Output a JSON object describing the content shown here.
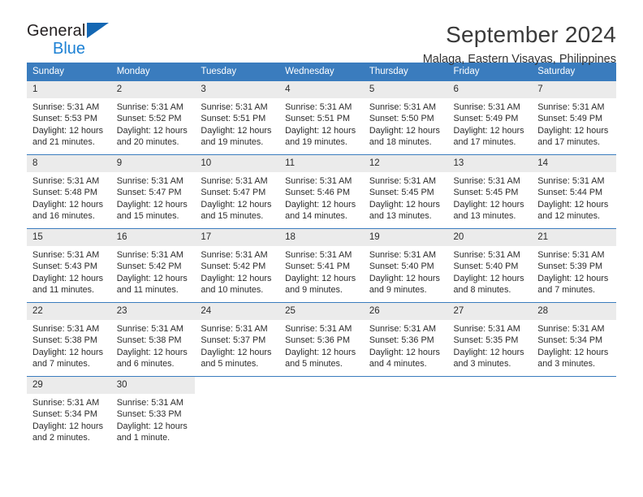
{
  "brand": {
    "name_top": "General",
    "name_bottom": "Blue",
    "triangle_color": "#1467b3",
    "blue_text_color": "#1d81d4"
  },
  "header": {
    "month_title": "September 2024",
    "location": "Malaga, Eastern Visayas, Philippines"
  },
  "theme": {
    "header_blue": "#3a7cbe",
    "daynum_bg": "#ebebeb",
    "text": "#2b2b2b"
  },
  "calendar": {
    "day_names": [
      "Sunday",
      "Monday",
      "Tuesday",
      "Wednesday",
      "Thursday",
      "Friday",
      "Saturday"
    ],
    "weeks": [
      [
        {
          "day": "1",
          "sunrise": "Sunrise: 5:31 AM",
          "sunset": "Sunset: 5:53 PM",
          "daylight1": "Daylight: 12 hours",
          "daylight2": "and 21 minutes."
        },
        {
          "day": "2",
          "sunrise": "Sunrise: 5:31 AM",
          "sunset": "Sunset: 5:52 PM",
          "daylight1": "Daylight: 12 hours",
          "daylight2": "and 20 minutes."
        },
        {
          "day": "3",
          "sunrise": "Sunrise: 5:31 AM",
          "sunset": "Sunset: 5:51 PM",
          "daylight1": "Daylight: 12 hours",
          "daylight2": "and 19 minutes."
        },
        {
          "day": "4",
          "sunrise": "Sunrise: 5:31 AM",
          "sunset": "Sunset: 5:51 PM",
          "daylight1": "Daylight: 12 hours",
          "daylight2": "and 19 minutes."
        },
        {
          "day": "5",
          "sunrise": "Sunrise: 5:31 AM",
          "sunset": "Sunset: 5:50 PM",
          "daylight1": "Daylight: 12 hours",
          "daylight2": "and 18 minutes."
        },
        {
          "day": "6",
          "sunrise": "Sunrise: 5:31 AM",
          "sunset": "Sunset: 5:49 PM",
          "daylight1": "Daylight: 12 hours",
          "daylight2": "and 17 minutes."
        },
        {
          "day": "7",
          "sunrise": "Sunrise: 5:31 AM",
          "sunset": "Sunset: 5:49 PM",
          "daylight1": "Daylight: 12 hours",
          "daylight2": "and 17 minutes."
        }
      ],
      [
        {
          "day": "8",
          "sunrise": "Sunrise: 5:31 AM",
          "sunset": "Sunset: 5:48 PM",
          "daylight1": "Daylight: 12 hours",
          "daylight2": "and 16 minutes."
        },
        {
          "day": "9",
          "sunrise": "Sunrise: 5:31 AM",
          "sunset": "Sunset: 5:47 PM",
          "daylight1": "Daylight: 12 hours",
          "daylight2": "and 15 minutes."
        },
        {
          "day": "10",
          "sunrise": "Sunrise: 5:31 AM",
          "sunset": "Sunset: 5:47 PM",
          "daylight1": "Daylight: 12 hours",
          "daylight2": "and 15 minutes."
        },
        {
          "day": "11",
          "sunrise": "Sunrise: 5:31 AM",
          "sunset": "Sunset: 5:46 PM",
          "daylight1": "Daylight: 12 hours",
          "daylight2": "and 14 minutes."
        },
        {
          "day": "12",
          "sunrise": "Sunrise: 5:31 AM",
          "sunset": "Sunset: 5:45 PM",
          "daylight1": "Daylight: 12 hours",
          "daylight2": "and 13 minutes."
        },
        {
          "day": "13",
          "sunrise": "Sunrise: 5:31 AM",
          "sunset": "Sunset: 5:45 PM",
          "daylight1": "Daylight: 12 hours",
          "daylight2": "and 13 minutes."
        },
        {
          "day": "14",
          "sunrise": "Sunrise: 5:31 AM",
          "sunset": "Sunset: 5:44 PM",
          "daylight1": "Daylight: 12 hours",
          "daylight2": "and 12 minutes."
        }
      ],
      [
        {
          "day": "15",
          "sunrise": "Sunrise: 5:31 AM",
          "sunset": "Sunset: 5:43 PM",
          "daylight1": "Daylight: 12 hours",
          "daylight2": "and 11 minutes."
        },
        {
          "day": "16",
          "sunrise": "Sunrise: 5:31 AM",
          "sunset": "Sunset: 5:42 PM",
          "daylight1": "Daylight: 12 hours",
          "daylight2": "and 11 minutes."
        },
        {
          "day": "17",
          "sunrise": "Sunrise: 5:31 AM",
          "sunset": "Sunset: 5:42 PM",
          "daylight1": "Daylight: 12 hours",
          "daylight2": "and 10 minutes."
        },
        {
          "day": "18",
          "sunrise": "Sunrise: 5:31 AM",
          "sunset": "Sunset: 5:41 PM",
          "daylight1": "Daylight: 12 hours",
          "daylight2": "and 9 minutes."
        },
        {
          "day": "19",
          "sunrise": "Sunrise: 5:31 AM",
          "sunset": "Sunset: 5:40 PM",
          "daylight1": "Daylight: 12 hours",
          "daylight2": "and 9 minutes."
        },
        {
          "day": "20",
          "sunrise": "Sunrise: 5:31 AM",
          "sunset": "Sunset: 5:40 PM",
          "daylight1": "Daylight: 12 hours",
          "daylight2": "and 8 minutes."
        },
        {
          "day": "21",
          "sunrise": "Sunrise: 5:31 AM",
          "sunset": "Sunset: 5:39 PM",
          "daylight1": "Daylight: 12 hours",
          "daylight2": "and 7 minutes."
        }
      ],
      [
        {
          "day": "22",
          "sunrise": "Sunrise: 5:31 AM",
          "sunset": "Sunset: 5:38 PM",
          "daylight1": "Daylight: 12 hours",
          "daylight2": "and 7 minutes."
        },
        {
          "day": "23",
          "sunrise": "Sunrise: 5:31 AM",
          "sunset": "Sunset: 5:38 PM",
          "daylight1": "Daylight: 12 hours",
          "daylight2": "and 6 minutes."
        },
        {
          "day": "24",
          "sunrise": "Sunrise: 5:31 AM",
          "sunset": "Sunset: 5:37 PM",
          "daylight1": "Daylight: 12 hours",
          "daylight2": "and 5 minutes."
        },
        {
          "day": "25",
          "sunrise": "Sunrise: 5:31 AM",
          "sunset": "Sunset: 5:36 PM",
          "daylight1": "Daylight: 12 hours",
          "daylight2": "and 5 minutes."
        },
        {
          "day": "26",
          "sunrise": "Sunrise: 5:31 AM",
          "sunset": "Sunset: 5:36 PM",
          "daylight1": "Daylight: 12 hours",
          "daylight2": "and 4 minutes."
        },
        {
          "day": "27",
          "sunrise": "Sunrise: 5:31 AM",
          "sunset": "Sunset: 5:35 PM",
          "daylight1": "Daylight: 12 hours",
          "daylight2": "and 3 minutes."
        },
        {
          "day": "28",
          "sunrise": "Sunrise: 5:31 AM",
          "sunset": "Sunset: 5:34 PM",
          "daylight1": "Daylight: 12 hours",
          "daylight2": "and 3 minutes."
        }
      ],
      [
        {
          "day": "29",
          "sunrise": "Sunrise: 5:31 AM",
          "sunset": "Sunset: 5:34 PM",
          "daylight1": "Daylight: 12 hours",
          "daylight2": "and 2 minutes."
        },
        {
          "day": "30",
          "sunrise": "Sunrise: 5:31 AM",
          "sunset": "Sunset: 5:33 PM",
          "daylight1": "Daylight: 12 hours",
          "daylight2": "and 1 minute."
        },
        null,
        null,
        null,
        null,
        null
      ]
    ]
  }
}
